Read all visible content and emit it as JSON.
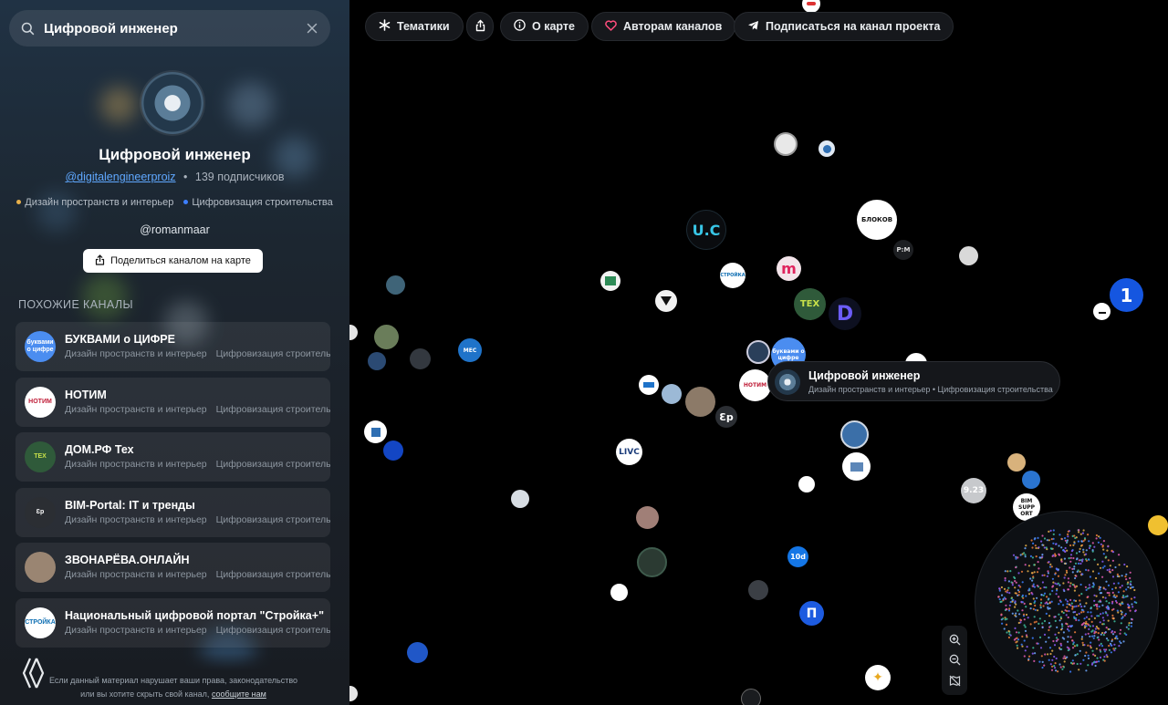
{
  "search": {
    "value": "Цифровой инженер"
  },
  "channel": {
    "title": "Цифровой инженер",
    "handle": "@digitalengineerproiz",
    "subscribers": "139 подписчиков",
    "tags": [
      {
        "label": "Дизайн пространств и интерьер",
        "color": "#e8b04a"
      },
      {
        "label": "Цифровизация строительства",
        "color": "#3d7fff"
      }
    ],
    "admin": "@romanmaar",
    "share_label": "Поделиться каналом на карте"
  },
  "similar": {
    "heading": "ПОХОЖИЕ КАНАЛЫ",
    "items": [
      {
        "name": "БУКВАМИ о ЦИФРЕ",
        "logo_text": "буквами о цифре",
        "logo_bg": "#4b8df0",
        "logo_fg": "#ffffff",
        "tag1": "Дизайн пространств и интерьер",
        "tag2": "Цифровизация строительства"
      },
      {
        "name": "НОТИМ",
        "logo_text": "НОТИМ",
        "logo_bg": "#ffffff",
        "logo_fg": "#c0203a",
        "tag1": "Дизайн пространств и интерьер",
        "tag2": "Цифровизация строительства"
      },
      {
        "name": "ДОМ.РФ Тех",
        "logo_text": "ТЕХ",
        "logo_bg": "#2f5a3a",
        "logo_fg": "#c7e04a",
        "tag1": "Дизайн пространств и интерьер",
        "tag2": "Цифровизация строительства"
      },
      {
        "name": "BIM-Portal: IT и тренды",
        "logo_text": "Ɛp",
        "logo_bg": "#2b2e33",
        "logo_fg": "#ffffff",
        "tag1": "Дизайн пространств и интерьер",
        "tag2": "Цифровизация строительства"
      },
      {
        "name": "ЗВОНАРЁВА.ОНЛАЙН",
        "logo_text": "",
        "logo_bg": "#9a8572",
        "logo_fg": "#ffffff",
        "tag1": "Дизайн пространств и интерьер",
        "tag2": "Цифровизация строительства"
      },
      {
        "name": "Национальный цифровой портал \"Стройка+\"",
        "logo_text": "СТРОЙКА",
        "logo_bg": "#ffffff",
        "logo_fg": "#0f6fb3",
        "tag1": "Дизайн пространств и интерьер",
        "tag2": "Цифровизация строительства"
      }
    ]
  },
  "footer": {
    "text": "Если данный материал нарушает ваши права, законодательство или вы хотите скрыть свой канал,",
    "link": "сообщите нам"
  },
  "toolbar": {
    "topics": "Тематики",
    "about": "О карте",
    "authors": "Авторам каналов",
    "subscribe": "Подписаться на канал проекта"
  },
  "tooltip": {
    "title": "Цифровой инженер",
    "subtitle": "Дизайн пространств и интерьер • Цифровизация строительства"
  },
  "map_labels": {
    "uc": "U.C",
    "bloknot": "БЛОКОВ",
    "pm": "P:M",
    "m": "m",
    "dom_tex": "ТЕХ",
    "d": "D",
    "bukvami": "буквами о цифре",
    "livc": "LIVC",
    "bp": "Ɛp",
    "tech10d": "10d",
    "bim_support": "BIM SUPP ORT",
    "v123": "9.23",
    "stroyka": "СТРОЙКА"
  },
  "colors": {
    "accent": "#3d7fff",
    "design_tag": "#e8b04a",
    "digital_tag": "#3d7fff"
  }
}
